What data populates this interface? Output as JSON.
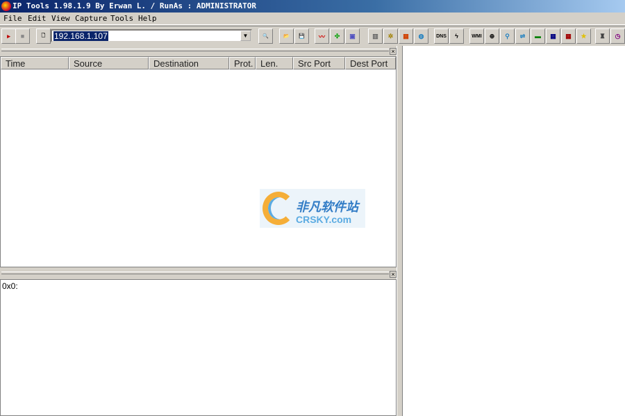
{
  "window": {
    "title": "IP Tools 1.98.1.9 By Erwan L. / RunAs : ADMINISTRATOR"
  },
  "menu": [
    "File",
    "Edit",
    "View",
    "Capture",
    "Tools",
    "Help"
  ],
  "toolbar": {
    "address_value": "192.168.1.107",
    "buttons": [
      {
        "name": "start-capture",
        "icon": "play-icon",
        "label": "▸",
        "color": "#c00000"
      },
      {
        "name": "stop-capture",
        "icon": "stop-icon",
        "label": "■",
        "color": "#888888"
      },
      {
        "name": "new",
        "icon": "document-icon",
        "label": "🗋",
        "color": "#000000"
      },
      {
        "name": "search",
        "icon": "magnifier-icon",
        "label": "🔍",
        "color": "#333333"
      },
      {
        "name": "open",
        "icon": "folder-icon",
        "label": "📂",
        "color": "#c8a000"
      },
      {
        "name": "save",
        "icon": "floppy-icon",
        "label": "💾",
        "color": "#000000"
      },
      {
        "name": "graph",
        "icon": "line-graph-icon",
        "label": "〰",
        "color": "#d00000"
      },
      {
        "name": "network",
        "icon": "network-nodes-icon",
        "label": "✣",
        "color": "#00a000"
      },
      {
        "name": "computers",
        "icon": "computers-icon",
        "label": "▣",
        "color": "#5050c0"
      },
      {
        "name": "servers",
        "icon": "servers-icon",
        "label": "▥",
        "color": "#666666"
      },
      {
        "name": "services",
        "icon": "gears-icon",
        "label": "✲",
        "color": "#a08000"
      },
      {
        "name": "firewall",
        "icon": "firewall-icon",
        "label": "▦",
        "color": "#d04000"
      },
      {
        "name": "internet",
        "icon": "globe-icon",
        "label": "◍",
        "color": "#2080c0"
      },
      {
        "name": "dns",
        "icon": "dns-icon",
        "label": "DNS",
        "color": "#000000"
      },
      {
        "name": "trace",
        "icon": "trace-icon",
        "label": "ϟ",
        "color": "#000000"
      },
      {
        "name": "wmi",
        "icon": "wmi-icon",
        "label": "WMI",
        "color": "#000000"
      },
      {
        "name": "scan",
        "icon": "crosshair-icon",
        "label": "⊕",
        "color": "#000000"
      },
      {
        "name": "users",
        "icon": "users-icon",
        "label": "⚲",
        "color": "#2080c0"
      },
      {
        "name": "connections",
        "icon": "connections-icon",
        "label": "⇌",
        "color": "#2080c0"
      },
      {
        "name": "nic",
        "icon": "network-card-icon",
        "label": "▬",
        "color": "#008000"
      },
      {
        "name": "table",
        "icon": "table-icon",
        "label": "▦",
        "color": "#000080"
      },
      {
        "name": "table-red",
        "icon": "table-red-icon",
        "label": "▦",
        "color": "#a00000"
      },
      {
        "name": "favorites",
        "icon": "star-icon",
        "label": "★",
        "color": "#e0c000"
      },
      {
        "name": "remote-admin",
        "icon": "remote-admin-icon",
        "label": "♜",
        "color": "#404040"
      },
      {
        "name": "scheduler",
        "icon": "clock-user-icon",
        "label": "◷",
        "color": "#800080"
      }
    ]
  },
  "packets": {
    "columns": [
      "Time",
      "Source",
      "Destination",
      "Prot.",
      "Len.",
      "Src Port",
      "Dest Port"
    ],
    "rows": []
  },
  "hex": {
    "line": "0x0:"
  },
  "watermark": {
    "cn": "非凡软件站",
    "en": "CRSKY.com"
  }
}
